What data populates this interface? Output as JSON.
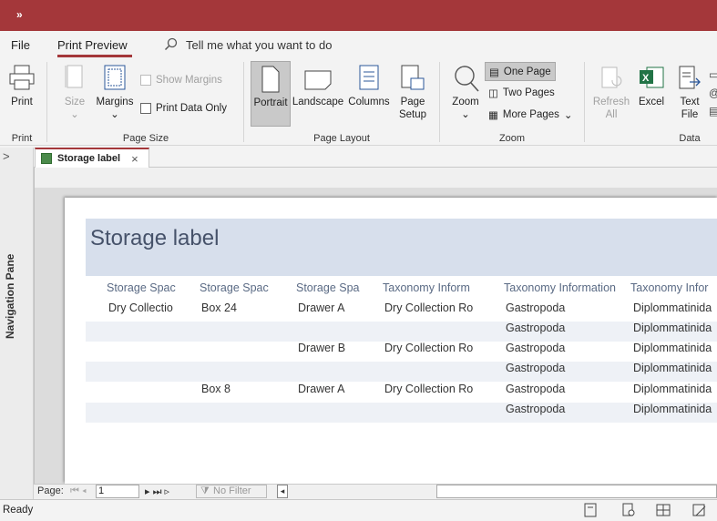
{
  "app": {
    "qat_glyph": "»",
    "status": "Ready"
  },
  "menu": {
    "file": "File",
    "print_preview": "Print Preview",
    "tell_me": "Tell me what you want to do"
  },
  "ribbon": {
    "print": {
      "label": "Print",
      "group": "Print"
    },
    "page_size": {
      "size": "Size",
      "margins": "Margins",
      "show_margins": "Show Margins",
      "print_data_only": "Print Data Only",
      "group": "Page Size"
    },
    "page_layout": {
      "portrait": "Portrait",
      "landscape": "Landscape",
      "columns": "Columns",
      "page_setup_1": "Page",
      "page_setup_2": "Setup",
      "group": "Page Layout"
    },
    "zoom": {
      "zoom": "Zoom",
      "one_page": "One Page",
      "two_pages": "Two Pages",
      "more_pages": "More Pages",
      "group": "Zoom"
    },
    "data": {
      "refresh_1": "Refresh",
      "refresh_2": "All",
      "excel": "Excel",
      "text_1": "Text",
      "text_2": "File",
      "group": "Data"
    }
  },
  "nav_pane": {
    "label": "Navigation Pane",
    "toggle": ">"
  },
  "tab": {
    "label": "Storage label",
    "close": "×"
  },
  "report": {
    "title": "Storage label",
    "columns": [
      "Storage Spac",
      "Storage Spac",
      "Storage Spa",
      "Taxonomy Inform",
      "Taxonomy Information",
      "Taxonomy Infor"
    ],
    "rows": [
      [
        "Dry Collectio",
        "Box 24",
        "Drawer A",
        "Dry Collection Ro",
        "Gastropoda",
        "Diplommatinida"
      ],
      [
        "",
        "",
        "",
        "",
        "Gastropoda",
        "Diplommatinida"
      ],
      [
        "",
        "",
        "Drawer B",
        "Dry Collection Ro",
        "Gastropoda",
        "Diplommatinida"
      ],
      [
        "",
        "",
        "",
        "",
        "Gastropoda",
        "Diplommatinida"
      ],
      [
        "",
        "Box 8",
        "Drawer A",
        "Dry Collection Ro",
        "Gastropoda",
        "Diplommatinida"
      ],
      [
        "",
        "",
        "",
        "",
        "Gastropoda",
        "Diplommatinida"
      ]
    ]
  },
  "pagebar": {
    "page_label": "Page:",
    "page_value": "1",
    "filter": "No Filter"
  }
}
